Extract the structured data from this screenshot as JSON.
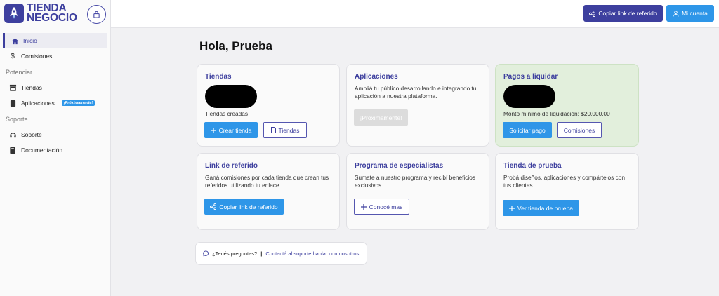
{
  "brand": {
    "line1": "TIENDA",
    "line2": "NEGOCIO"
  },
  "sidebar": {
    "items": [
      {
        "label": "Inicio",
        "icon": "home-icon"
      },
      {
        "label": "Comisiones",
        "icon": "dollar-icon"
      }
    ],
    "section_potenciar": "Potenciar",
    "potenciar_items": [
      {
        "label": "Tiendas",
        "icon": "store-icon"
      },
      {
        "label": "Aplicaciones",
        "icon": "apps-icon",
        "badge": "¡Próximamente!"
      }
    ],
    "section_soporte": "Soporte",
    "soporte_items": [
      {
        "label": "Soporte",
        "icon": "headset-icon"
      },
      {
        "label": "Documentación",
        "icon": "book-icon"
      }
    ]
  },
  "header": {
    "referral_button": "Copiar link de referido",
    "account_button": "Mi cuenta"
  },
  "main": {
    "title": "Hola, Prueba",
    "cards": {
      "tiendas": {
        "title": "Tiendas",
        "caption": "Tiendas creadas",
        "primary": "Crear tienda",
        "secondary": "Tiendas"
      },
      "aplicaciones": {
        "title": "Aplicaciones",
        "text": "Ampliá tu público desarrollando e integrando tu aplicación a nuestra plataforma.",
        "button": "¡Próximamente!"
      },
      "pagos": {
        "title": "Pagos a liquidar",
        "caption": "Monto mínimo de liquidación: $20,000.00",
        "primary": "Solicitar pago",
        "secondary": "Comisiones"
      },
      "referido": {
        "title": "Link de referido",
        "text": "Ganá comisiones por cada tienda que crean tus referidos utilizando tu enlace.",
        "button": "Copiar link de referido"
      },
      "especialistas": {
        "title": "Programa de especialistas",
        "text": "Sumate a nuestro programa y recibí beneficios exclusivos.",
        "button": "Conocé mas"
      },
      "prueba": {
        "title": "Tienda de prueba",
        "text": "Probá diseños, aplicaciones y compártelos con tus clientes.",
        "button": "Ver tienda de prueba"
      }
    },
    "help": {
      "question": "¿Tenés preguntas?",
      "separator": "|",
      "link": "Contactá al soporte hablar con nosotros"
    }
  },
  "colors": {
    "brand": "#3d3f9e",
    "accent": "#2e96e8",
    "green_card": "#e2efdc"
  }
}
